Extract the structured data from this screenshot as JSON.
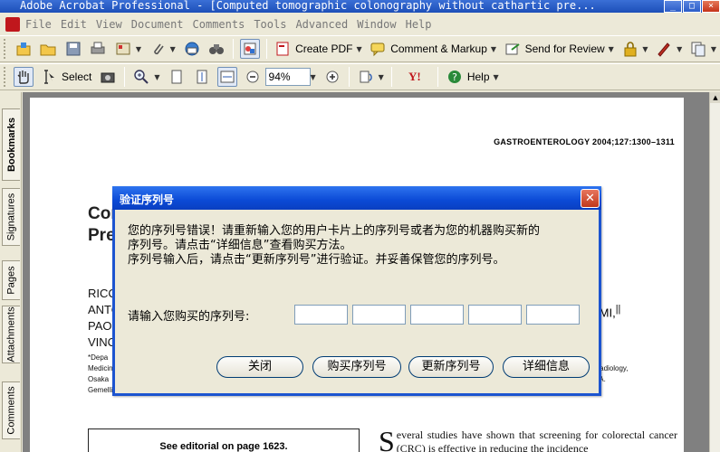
{
  "window": {
    "title": "Adobe Acrobat Professional - [Computed tomographic colonography without cathartic pre...",
    "minimize": "_",
    "maximize": "□",
    "close": "×"
  },
  "menu": [
    "File",
    "Edit",
    "View",
    "Document",
    "Comments",
    "Tools",
    "Advanced",
    "Window",
    "Help"
  ],
  "toolbar": {
    "create_pdf": "Create PDF",
    "comment_markup": "Comment & Markup",
    "send_review": "Send for Review",
    "select": "Select",
    "zoom": "94%",
    "help": "Help",
    "yahoo": "Y!"
  },
  "nav_tabs": [
    "Bookmarks",
    "Signatures",
    "Pages",
    "Attachments",
    "Comments"
  ],
  "document": {
    "journal": "GASTROENTEROLOGY 2004;127:1300–1311",
    "title_lines": [
      "Cor",
      "Pre"
    ],
    "authors": [
      "RICC",
      "ANTO",
      "PAOL",
      "VINC"
    ],
    "ami": "AMI,",
    "affil_left": [
      "*Depa",
      "Medicin",
      "Osaka",
      "Gemelli"
    ],
    "affil_right": [
      "ental",
      "t of Radiology,",
      "linco A."
    ],
    "editorial": "See editorial on page 1623.",
    "dropcap": "S",
    "body": "everal studies have shown that screening for colorectal cancer (CRC) is effective in reducing the incidence"
  },
  "dialog": {
    "title": "验证序列号",
    "message_lines": [
      "您的序列号错误！请重新输入您的用户卡片上的序列号或者为您的机器购买新的",
      "序列号。请点击“详细信息”查看购买方法。",
      "序列号输入后，请点击“更新序列号”进行验证。并妥善保管您的序列号。"
    ],
    "serial_label": "请输入您购买的序列号:",
    "serial_fields": [
      "",
      "",
      "",
      "",
      ""
    ],
    "buttons": {
      "close": "关闭",
      "buy": "购买序列号",
      "update": "更新序列号",
      "details": "详细信息"
    }
  }
}
